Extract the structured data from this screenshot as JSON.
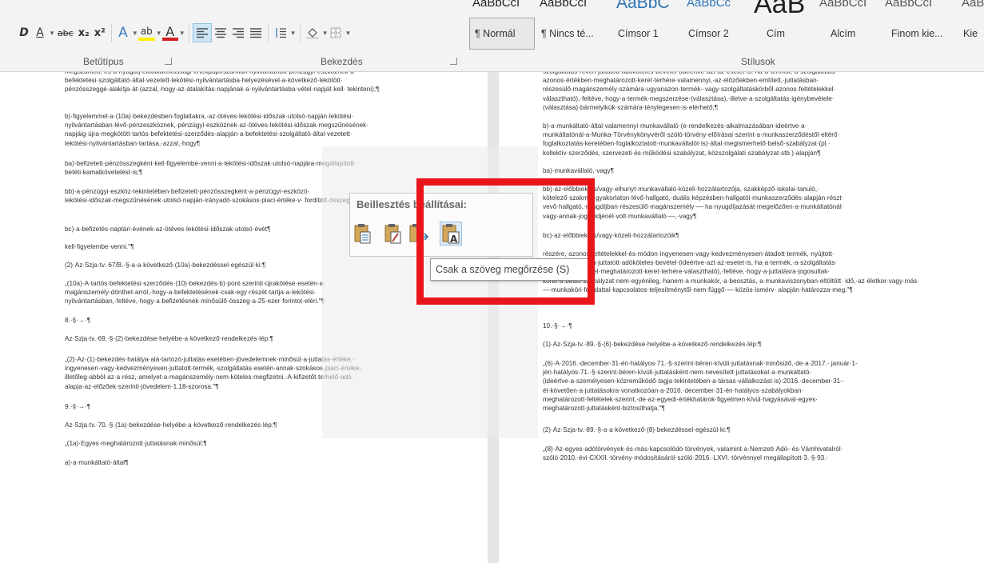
{
  "ribbon": {
    "font_group_label": "Betűtípus",
    "paragraph_group_label": "Bekezdés",
    "styles_group_label": "Stílusok",
    "font_buttons": {
      "bold": "D",
      "underline": "A",
      "strike": "abc",
      "subscript": "x₂",
      "superscript": "x²",
      "effects": "A",
      "highlight": "ab",
      "font_color": "A"
    },
    "styles": [
      {
        "preview": "AaBbCcI",
        "label": "¶ Normál"
      },
      {
        "preview": "AaBbCcI",
        "label": "¶ Nincs té..."
      },
      {
        "preview": "AaBbC",
        "label": "Címsor 1"
      },
      {
        "preview": "AaBbCc",
        "label": "Címsor 2"
      },
      {
        "preview": "AaB",
        "label": "Cím"
      },
      {
        "preview": "AaBbCcI",
        "label": "Alcím"
      },
      {
        "preview": "AaBbCcI",
        "label": "Finom kie..."
      },
      {
        "preview": "AaBb",
        "label": "Kie"
      }
    ]
  },
  "document": {
    "left_page": [
      "megszünteti,·és·a·nyugdíj-előtakarékossági·értékpapírszámlán·nyilvántartott·pénzügyi·eszköznek·a· befektetési·szolgáltató·által·vezetett·lekötési·nyilvántartásba·helyezésével·a·következő·lekötött· pénzösszeggé·alakítja·át·(azzal,·hogy·az·átalakítás·napjának·a·nyilvántartásba·vétel·napját·kell· tekinteni);¶",
      "b)·figyelemmel·a·(10a)·bekezdésben·foglaltakra,·az·ötéves·lekötési·időszak·utolsó·napján·lekötési· nyilvántartásban·lévő·pénzeszköznek,·pénzügyi·eszköznek·az·ötéves·lekötési·időszak·megszűnésének· napjáig·újra·megkötött·tartós·befektetési·szerződés·alapján·a·befektetési·szolgáltató·által·vezetett· lekötési·nyilvántartásban·tartása,·azzal,·hogy¶",
      "ba)·befizetett·pénzösszegként·kell·figyelembe·venni·a·lekötési·időszak·utolsó·napjára·megállapított· betéti·kamatkövetelést·is;¶",
      "bb)·a·pénzügyi·eszköz·tekintetében·befizetett·pénzösszegként·a·pénzügyi·eszközö· lekötési·időszak·megszűnésének·utolsó·napján·irányadó·szokásos·piaci·értéke·v· fordított·összeg·közül·a·nagyobbat;¶",
      "bc)·a·befizetés·naptári·évének·az·ötéves·lekötési·időszak·utolsó·évét¶",
      "kell·figyelembe·venni.\"¶",
      "(2)·Az·Szja·tv.·67/B.·§-a·a·következő·(10a)·bekezdéssel·egészül·ki:¶",
      "„(10a)·A·tartós·befektetési·szerződés·(10)·bekezdés·b)·pont·szerinti·újrakötése·esetén·a· magánszemély·dönthet·arról,·hogy·a·befektetésének·csak·egy·részét·tartja·a·lekötési· nyilvántartásban,·feltéve,·hogy·a·befizetésnek·minősülő·összeg·a·25·ezer·forintot·eléri.\"¶",
      "8.·§·→·¶",
      "Az·Szja·tv.·69.·§·(2)·bekezdése·helyébe·a·következő·rendelkezés·lép:¶",
      "„(2)·Az·(1)·bekezdés·hatálya·alá·tartozó·juttatás·esetében·jövedelemnek·minősül·a·juttatás·értéke,· ingyenesen·vagy·kedvezményesen·juttatott·termék,·szolgáltatás·esetén·annak·szokásos·piaci·értéke,· illetőleg·abból·az·a·rész,·amelyet·a·magánszemély·nem·köteles·megfizetni.·A·kifizetőt·terhelő·adó· alapja·az·előzőek·szerinti·jövedelem·1,18-szorosa.\"¶",
      "9.·§·→·¶",
      "Az·Szja·tv.·70.·§·(1a)·bekezdése·helyébe·a·következő·rendelkezés·lép:¶",
      "„(1a)·Egyes·meghatározott·juttatásnak·minősül:¶",
      "a)·a·munkáltató·által¶"
    ],
    "right_page": [
      "szolgáltatás·révén·juttatott·adóköteles·bevétel·(ideértve·azt·az·esetet·is,·ha·a·termék,·a·szolgáltatás· azonos·értékben·meghatározott·keret·terhére·valamennyi,·az·előzőekben·említett,·juttatásban· részesülő·magánszemély·számára·ugyanazon·termék-·vagy·szolgáltatáskörből·azonos·feltételekkel· választható),·feltéve,·hogy·a·termék·megszerzése·(választása),·illetve·a·szolgáltatás·igénybevétele· (választása)·bármelyikük·számára·ténylegesen·is·elérhető;¶",
      "b)·a·munkáltató·által·valamennyi·munkavállaló·(e·rendelkezés·alkalmazásában·ideértve·a· munkáltatónál·a·Munka·Törvénykönyvéről·szóló·törvény·előírásai·szerint·a·munkaszerződéstől·eltérő· foglalkoztatás·keretében·foglalkoztatott·munkavállalót·is)·által·megismerhető·belső·szabályzat·(pl.· kollektív·szerződés,·szervezeti·és·működési·szabályzat,·közszolgálati·szabályzat·stb.)·alapján¶",
      "ba)·munkavállaló,·vagy¶",
      "bb)·az·előbbiek·és/vagy·elhunyt·munkavállaló·közeli·hozzátartozója,·szakképző·iskolai·tanuló,· kötelező·szakmai·gyakorlaton·lévő·hallgató,·duális·képzésben·hallgatói·munkaszerződés·alapján·részt· vevő·hallgató,·nyugdíjban·részesülő·magánszemély·—·ha·nyugdíjazását·megelőzően·a·munkáltatónál· vagy·annak·jogelődjénél·volt·munkavállaló·—,·vagy¶",
      "bc)·az·előbbiek·és/vagy·közeli·hozzátartozóik¶",
      "részére,·azonos·feltételekkel·és·módon·ingyenesen·vagy·kedvezményesen·átadott·termék,·nyújtott· szolgáltatás·révén·juttatott·adóköteles·bevétel·(ideértve·azt·az·esetet·is,·ha·a·termék,·a·szolgáltatás· azonos·módszerrel·meghatározott·keret·terhére·választható),·feltéve,·hogy·a·juttatásra·jogosultak· körét·a·belső·szabályzat·nem·egyénileg,·hanem·a·munkakör,·a·beosztás,·a·munkaviszonyban·eltöltött· idő,·az·életkor·vagy·más·—·munkaköri·feladattal·kapcsolatos·teljesítménytől·nem·függő·—·közös·ismérv· alapján·határozza·meg.\"¶",
      "10.·§·→·¶",
      "(1)·Az·Szja·tv.·89.·§·(6)·bekezdése·helyébe·a·következő·rendelkezés·lép:¶",
      "„(6)·A·2016.·december·31-én·hatályos·71.·§·szerint·béren·kívüli·juttatásnak·minősülő,·de·a·2017.· január·1-jén·hatályos·71.·§·szerint·béren·kívüli·juttatásként·nem·nevesített·juttatásokat·a·munkáltató· (ideértve·a·személyesen·közreműködő·tagja·tekintetében·a·társas·vállalkozást·is)·2016.·december·31-· ét·követően·a·juttatásokra·vonatkozóan·a·2016.·december·31-én·hatályos·szabályokban· meghatározott·feltételek·szerint,·de·az·egyedi·értékhatárok·figyelmen·kívül·hagyásával·egyes· meghatározott·juttatásként·biztosíthatja.\"¶",
      "(2)·Az·Szja·tv.·89.·§-a·a·következő·(8)·bekezdéssel·egészül·ki:¶",
      "„(8)·Az·egyes·adótörvények·és·más·kapcsolódó·törvények,·valamint·a·Nemzeti·Adó-·és·Vámhivatalról· szóló·2010.·évi·CXXII.·törvény·módosításáról·szóló·2016.·LXVI.·törvénnyel·megállapított·3.·§·93.·"
    ]
  },
  "paste_popup": {
    "title": "Beillesztés beállításai:",
    "options": [
      "keep-source-formatting",
      "merge-formatting",
      "picture",
      "keep-text-only"
    ],
    "tooltip": "Csak a szöveg megőrzése (S)"
  },
  "colors": {
    "highlight_box": "#e8151b",
    "heading_blue": "#2e74b5"
  }
}
